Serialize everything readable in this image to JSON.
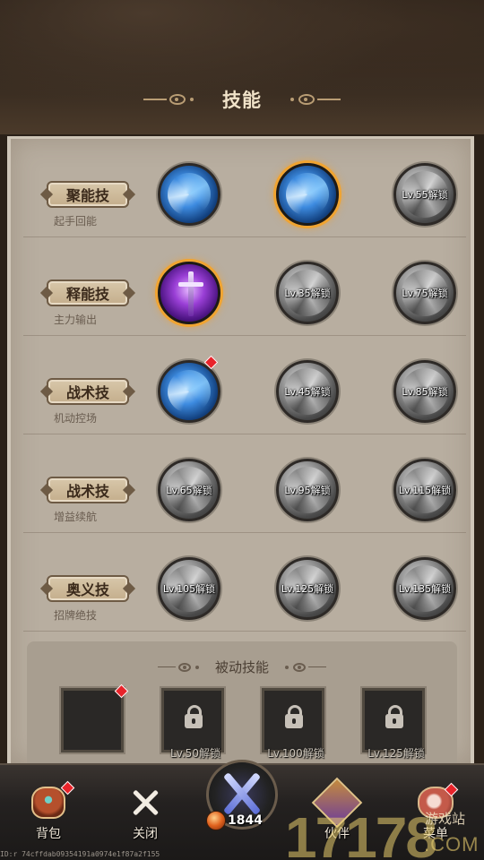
{
  "header": {
    "title": "技能"
  },
  "rows": [
    {
      "category": "聚能技",
      "subtitle": "起手回能",
      "skills": [
        {
          "state": "blue",
          "label": ""
        },
        {
          "state": "blue-selected",
          "label": ""
        },
        {
          "state": "locked",
          "label": "Lv.55解锁"
        }
      ]
    },
    {
      "category": "释能技",
      "subtitle": "主力输出",
      "skills": [
        {
          "state": "purple-selected",
          "label": ""
        },
        {
          "state": "locked",
          "label": "Lv.35解锁"
        },
        {
          "state": "locked",
          "label": "Lv.75解锁"
        }
      ]
    },
    {
      "category": "战术技",
      "subtitle": "机动控场",
      "skills": [
        {
          "state": "blue",
          "label": "",
          "badge": true
        },
        {
          "state": "locked",
          "label": "Lv.45解锁"
        },
        {
          "state": "locked",
          "label": "Lv.85解锁"
        }
      ]
    },
    {
      "category": "战术技",
      "subtitle": "增益续航",
      "skills": [
        {
          "state": "locked",
          "label": "Lv.65解锁"
        },
        {
          "state": "locked",
          "label": "Lv.95解锁"
        },
        {
          "state": "locked",
          "label": "Lv.115解锁"
        }
      ]
    },
    {
      "category": "奥义技",
      "subtitle": "招牌绝技",
      "skills": [
        {
          "state": "locked",
          "label": "Lv.105解锁"
        },
        {
          "state": "locked",
          "label": "Lv.125解锁"
        },
        {
          "state": "locked",
          "label": "Lv.135解锁"
        }
      ]
    }
  ],
  "passive": {
    "title": "被动技能",
    "slots": [
      {
        "label": "",
        "locked": false,
        "badge": true
      },
      {
        "label": "Lv.50解锁",
        "locked": true
      },
      {
        "label": "Lv.100解锁",
        "locked": true
      },
      {
        "label": "Lv.125解锁",
        "locked": true
      }
    ]
  },
  "nav": {
    "bag": "背包",
    "close": "关闭",
    "power": "1844",
    "partner": "伙伴",
    "menu": "菜单"
  },
  "watermark": {
    "main": "17178",
    "site": "游戏站",
    "domain": ".COM"
  },
  "build_id": "ID:r 74cffdab09354191a0974e1f87a2f155",
  "colors": {
    "selected_glow": "#f0a431",
    "badge": "#e8232a",
    "panel": "#b8aea0"
  }
}
